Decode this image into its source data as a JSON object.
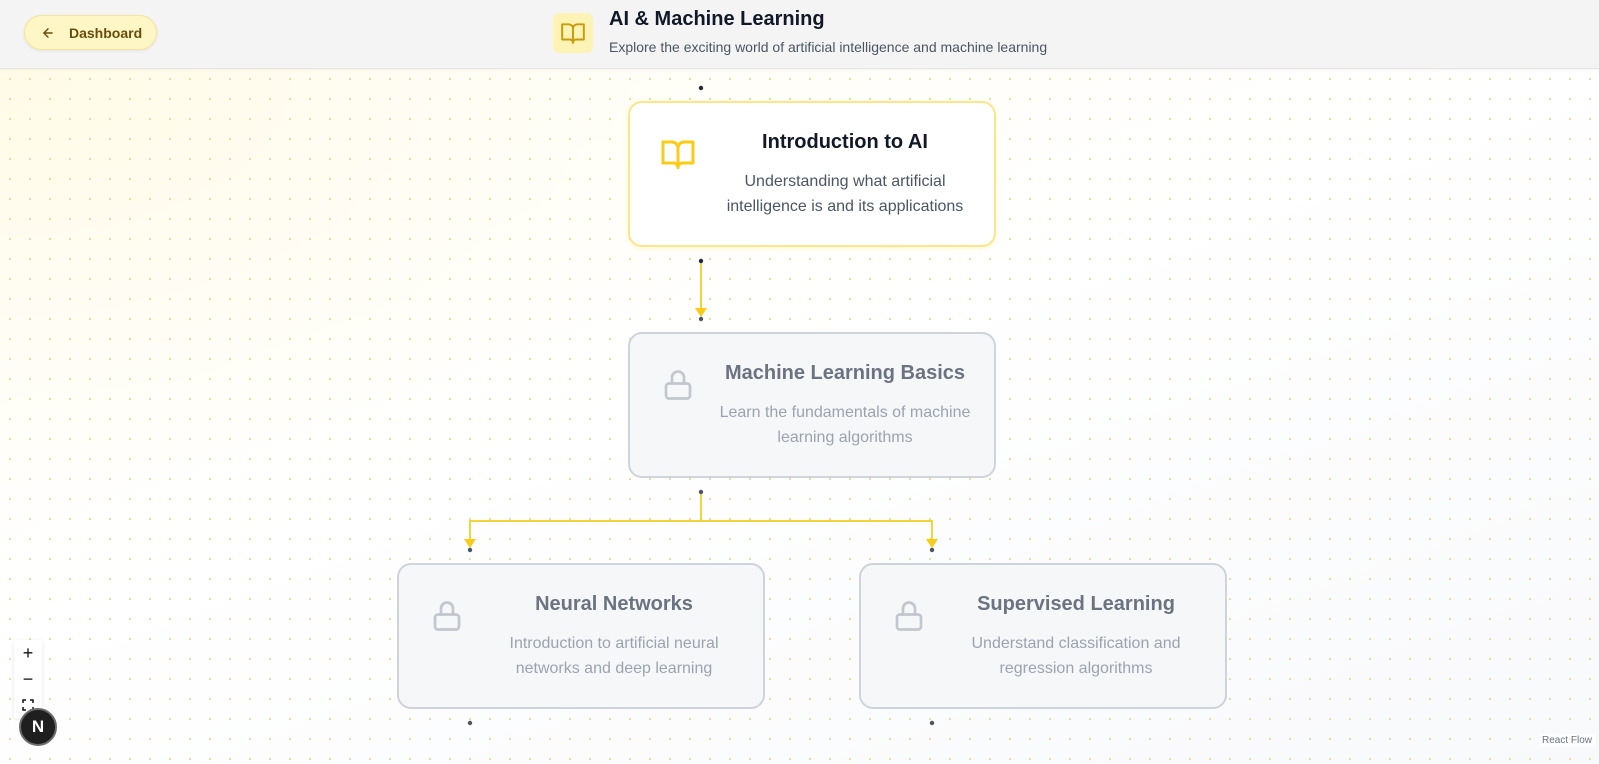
{
  "header": {
    "back_label": "Dashboard",
    "title": "AI & Machine Learning",
    "subtitle": "Explore the exciting world of artificial intelligence and machine learning",
    "title_icon": "book-open-icon"
  },
  "nodes": [
    {
      "title": "Introduction to AI",
      "description": "Understanding what artificial intelligence is and its applications",
      "status": "unlocked",
      "icon": "book-open-icon"
    },
    {
      "title": "Machine Learning Basics",
      "description": "Learn the fundamentals of machine learning algorithms",
      "status": "locked",
      "icon": "lock-icon"
    },
    {
      "title": "Neural Networks",
      "description": "Introduction to artificial neural networks and deep learning",
      "status": "locked",
      "icon": "lock-icon"
    },
    {
      "title": "Supervised Learning",
      "description": "Understand classification and regression algorithms",
      "status": "locked",
      "icon": "lock-icon"
    }
  ],
  "edges": [
    {
      "from": "Introduction to AI",
      "to": "Machine Learning Basics"
    },
    {
      "from": "Machine Learning Basics",
      "to": "Neural Networks"
    },
    {
      "from": "Machine Learning Basics",
      "to": "Supervised Learning"
    }
  ],
  "controls": {
    "zoom_in": "+",
    "zoom_out": "−",
    "logo": "N"
  },
  "attribution": "React Flow",
  "colors": {
    "accent": "#facc15",
    "accent_light": "#fef6c4",
    "locked_border": "#cfd3da"
  }
}
